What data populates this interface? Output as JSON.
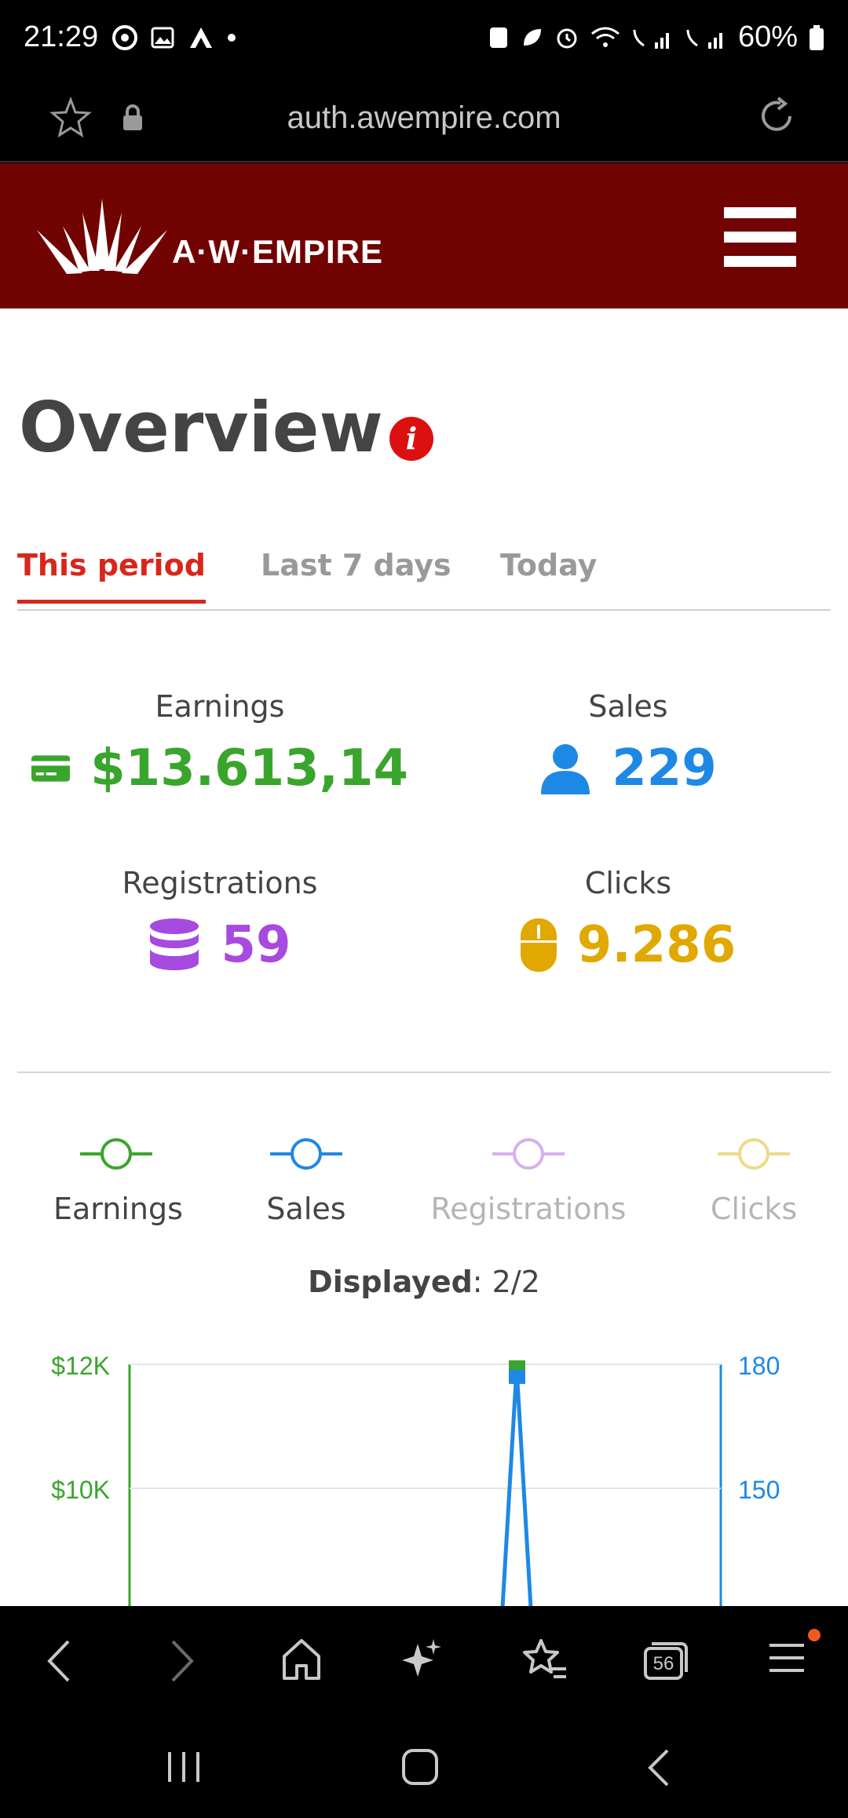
{
  "status_bar": {
    "time": "21:29",
    "battery": "60%"
  },
  "browser": {
    "url": "auth.awempire.com",
    "tab_count": "56"
  },
  "header": {
    "logo_text": "A·W·EMPIRE"
  },
  "page": {
    "title": "Overview",
    "info_glyph": "i"
  },
  "tabs": [
    {
      "label": "This period",
      "active": true
    },
    {
      "label": "Last 7 days",
      "active": false
    },
    {
      "label": "Today",
      "active": false
    }
  ],
  "stats": {
    "earnings": {
      "label": "Earnings",
      "value": "$13.613,14",
      "color": "#3aa52c",
      "icon": "credit-card-icon"
    },
    "sales": {
      "label": "Sales",
      "value": "229",
      "color": "#1e88e5",
      "icon": "user-icon"
    },
    "registrations": {
      "label": "Registrations",
      "value": "59",
      "color": "#a64ae0",
      "icon": "database-icon"
    },
    "clicks": {
      "label": "Clicks",
      "value": "9.286",
      "color": "#e0a800",
      "icon": "mouse-icon"
    }
  },
  "legend": [
    {
      "label": "Earnings",
      "color": "#3aa52c",
      "enabled": true
    },
    {
      "label": "Sales",
      "color": "#1e88e5",
      "enabled": true
    },
    {
      "label": "Registrations",
      "color": "#d8b0ee",
      "enabled": false
    },
    {
      "label": "Clicks",
      "color": "#efd98a",
      "enabled": false
    }
  ],
  "displayed": {
    "label": "Displayed",
    "value": ": 2/2"
  },
  "chart_data": {
    "type": "line",
    "left_axis": {
      "ticks": [
        "$12K",
        "$10K"
      ],
      "color": "#3aa52c"
    },
    "right_axis": {
      "ticks": [
        "180",
        "150"
      ],
      "color": "#1e88e5"
    },
    "series": [
      {
        "name": "Earnings",
        "color": "#3aa52c",
        "peak": 12000
      },
      {
        "name": "Sales",
        "color": "#1e88e5",
        "peak": 180
      }
    ]
  }
}
